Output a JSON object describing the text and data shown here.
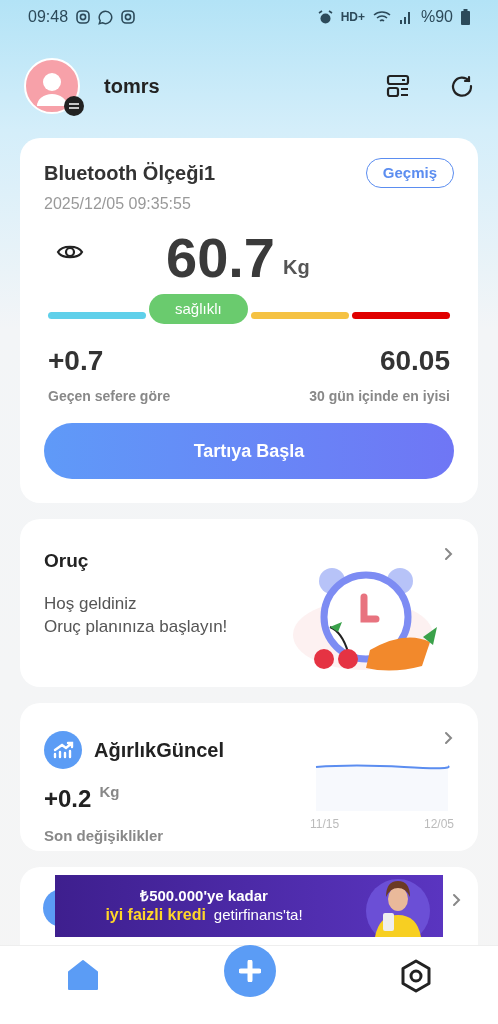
{
  "status_bar": {
    "time": "09:48",
    "network": "HD+",
    "battery": "%90"
  },
  "header": {
    "username": "tomrs"
  },
  "scale_card": {
    "title": "Bluetooth Ölçeği1",
    "history_button": "Geçmiş",
    "timestamp": "2025/12/05 09:35:55",
    "weight": "60.7",
    "unit": "Kg",
    "ranges": [
      {
        "color": "#5fd0ea",
        "selected": false
      },
      {
        "color": "#6acb6e",
        "selected": true,
        "label": "sağlıklı"
      },
      {
        "color": "#f5c243",
        "selected": false
      },
      {
        "color": "#e00000",
        "selected": false
      }
    ],
    "change": {
      "value": "+0.7",
      "label": "Geçen sefere göre"
    },
    "best": {
      "value": "60.05",
      "label": "30 gün içinde en iyisi"
    },
    "start_button": "Tartıya Başla"
  },
  "fasting_card": {
    "title": "Oruç",
    "lines": [
      "Hoş geldiniz",
      "Oruç planınıza başlayın!"
    ]
  },
  "trend_card": {
    "title": "AğırlıkGüncel",
    "value": "+0.2",
    "unit": "Kg",
    "label": "Son değişiklikler",
    "x_labels": [
      "11/15",
      "12/05"
    ]
  },
  "ad_banner": {
    "line_1": "₺500.000'ye kadar",
    "line_2": "iyi faizli kredi",
    "brand": "getirfinans'ta!"
  },
  "bottom_nav": [
    {
      "kind": "home",
      "selected": true
    },
    {
      "kind": "add",
      "selected": false
    },
    {
      "kind": "settings",
      "selected": false
    }
  ]
}
